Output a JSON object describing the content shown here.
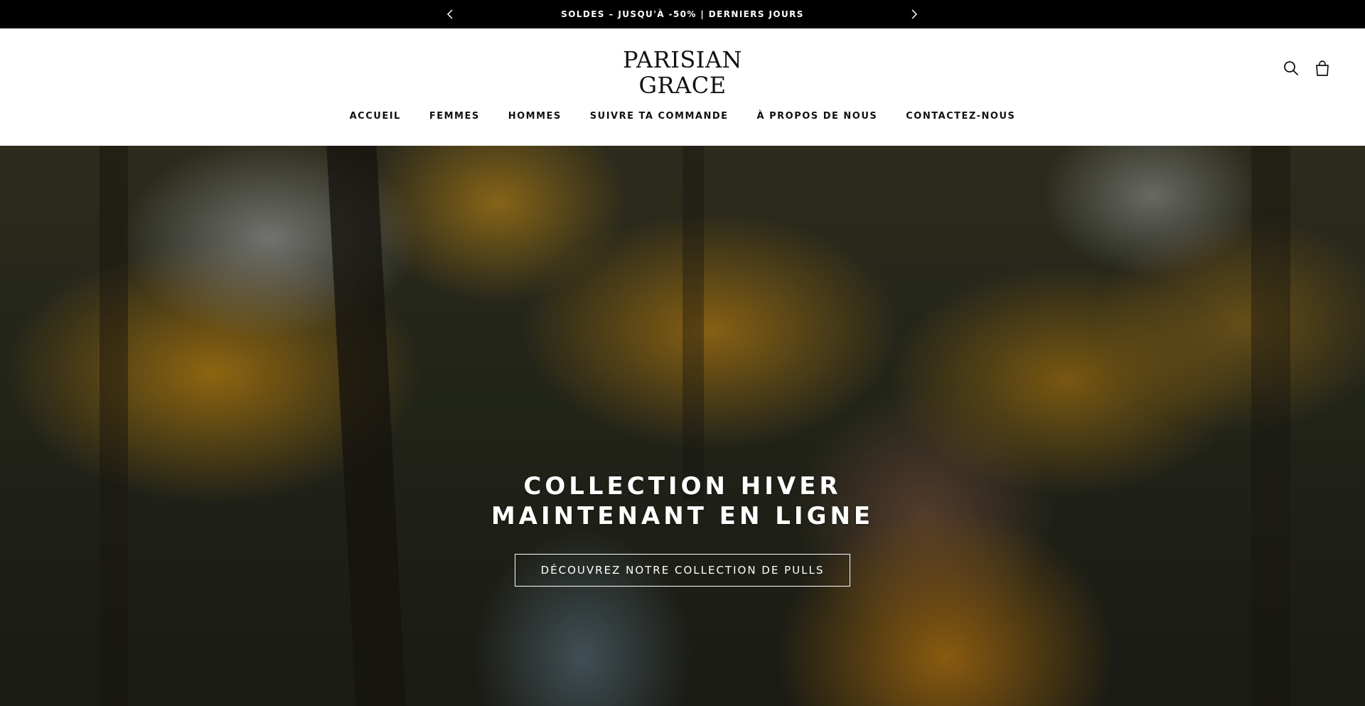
{
  "announcement": {
    "text": "SOLDES – JUSQU'À -50% | DERNIERS JOURS",
    "prev_icon": "chevron-left-icon",
    "next_icon": "chevron-right-icon"
  },
  "header": {
    "logo_line1": "PARISIAN",
    "logo_line2": "GRACE",
    "icons": [
      "search-icon",
      "shopping-bag-icon"
    ]
  },
  "nav": {
    "items": [
      {
        "label": "ACCUEIL"
      },
      {
        "label": "FEMMES"
      },
      {
        "label": "HOMMES"
      },
      {
        "label": "SUIVRE TA COMMANDE"
      },
      {
        "label": "À PROPOS DE NOUS"
      },
      {
        "label": "CONTACTEZ-NOUS"
      }
    ]
  },
  "hero": {
    "title_line1": "COLLECTION HIVER",
    "title_line2": "MAINTENANT EN LIGNE",
    "cta_label": "DÉCOUVREZ NOTRE COLLECTION DE PULLS"
  },
  "colors": {
    "announcement_bg": "#000000",
    "text_dark": "#111111",
    "hero_text": "#ffffff"
  }
}
